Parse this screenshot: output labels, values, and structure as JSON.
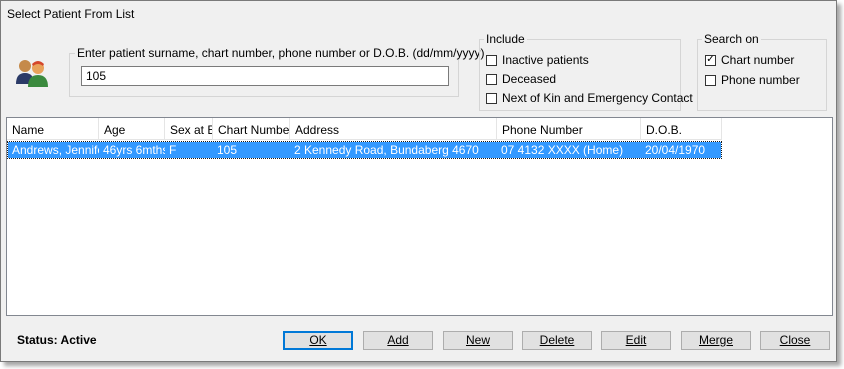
{
  "window": {
    "title": "Select Patient From List"
  },
  "search": {
    "prompt": "Enter patient surname, chart number, phone number or D.O.B. (dd/mm/yyyy)",
    "value": "105"
  },
  "include": {
    "label": "Include",
    "options": [
      {
        "label": "Inactive patients",
        "checked": false
      },
      {
        "label": "Deceased",
        "checked": false
      },
      {
        "label": "Next of Kin and Emergency Contact",
        "checked": false
      }
    ]
  },
  "search_on": {
    "label": "Search on",
    "options": [
      {
        "label": "Chart number",
        "checked": true
      },
      {
        "label": "Phone number",
        "checked": false
      }
    ]
  },
  "table": {
    "columns": [
      "Name",
      "Age",
      "Sex at B",
      "Chart Number",
      "Address",
      "Phone Number",
      "D.O.B."
    ],
    "rows": [
      [
        "Andrews, Jennifer",
        "46yrs 6mths",
        "F",
        "105",
        "2 Kennedy Road, Bundaberg 4670",
        "07 4132 XXXX (Home)",
        "20/04/1970"
      ]
    ],
    "selected_row": 0,
    "selection_color": "#3399ff"
  },
  "status": {
    "text": "Status: Active"
  },
  "buttons": {
    "ok": "OK",
    "add": "Add",
    "new": "New",
    "delete": "Delete",
    "edit": "Edit",
    "merge": "Merge",
    "close": "Close"
  },
  "icons": {
    "patients": "patients-icon",
    "check": "checkmark-icon"
  }
}
